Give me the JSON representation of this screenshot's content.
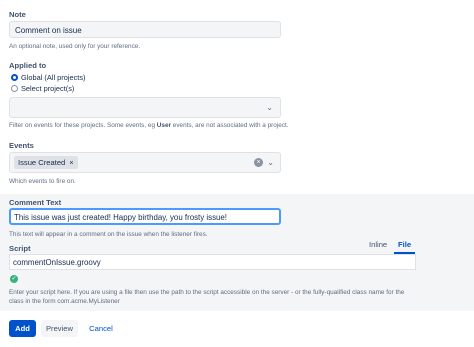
{
  "note": {
    "label": "Note",
    "value": "Comment on issue",
    "help": "An optional note, used only for your reference."
  },
  "applied_to": {
    "label": "Applied to",
    "options": [
      "Global (All projects)",
      "Select project(s)"
    ],
    "selected": "Global (All projects)",
    "help_before": "Filter on events for these projects. Some events, eg ",
    "help_bold": "User",
    "help_after": " events, are not associated with a project."
  },
  "events": {
    "label": "Events",
    "selected_tag": "Issue Created",
    "tag_remove": "×",
    "help": "Which events to fire on."
  },
  "comment_text": {
    "label": "Comment Text",
    "value": "This issue was just created! Happy birthday, you frosty issue!",
    "help": "This text will appear in a comment on the issue when the listener fires."
  },
  "script": {
    "label": "Script",
    "tabs": [
      "Inline",
      "File"
    ],
    "active_tab": "File",
    "file_value": "commentOnIssue.groovy",
    "status_icon": "check-circle-icon",
    "help_line1": "Enter your script here. If you are using a file then use the path to the script accessible on the server - or the fully-qualified class name for the",
    "help_line2": "class in the form com.acme.MyListener"
  },
  "actions": {
    "add": "Add",
    "preview": "Preview",
    "cancel": "Cancel"
  },
  "colors": {
    "primary": "#0052cc",
    "success": "#36b37e",
    "field_bg": "#f4f5f7"
  }
}
